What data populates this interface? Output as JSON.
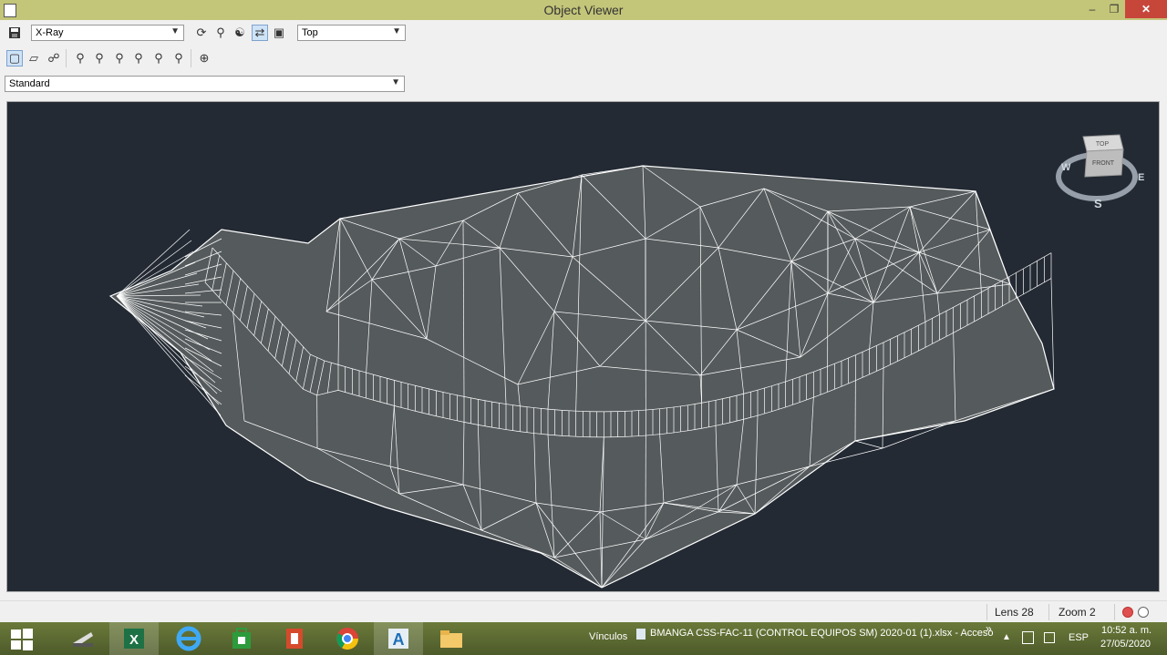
{
  "window": {
    "title": "Object Viewer",
    "minimize_glyph": "–",
    "maximize_glyph": "❐",
    "close_glyph": "✕"
  },
  "toolbar": {
    "visual_style": "X-Ray",
    "view": "Top",
    "render_preset": "Standard"
  },
  "viewcube": {
    "top_label": "TOP",
    "front_label": "FRONT",
    "west": "W",
    "east": "E",
    "south": "S"
  },
  "status": {
    "lens": "Lens 28",
    "zoom": "Zoom 2"
  },
  "taskbar": {
    "vinculos": "Vínculos",
    "excel_doc": "BMANGA CSS-FAC-11 (CONTROL EQUIPOS SM) 2020-01 (1).xlsx - Acceso",
    "language": "ESP",
    "time": "10:52 a. m.",
    "date": "27/05/2020",
    "chevron": "»"
  },
  "colors": {
    "titlebar": "#c3c579",
    "viewport_bg": "#232a33",
    "mesh_fill": "#555a5c",
    "mesh_lines": "#ffffff",
    "close_button": "#c7463a",
    "status_red": "#e05050"
  }
}
